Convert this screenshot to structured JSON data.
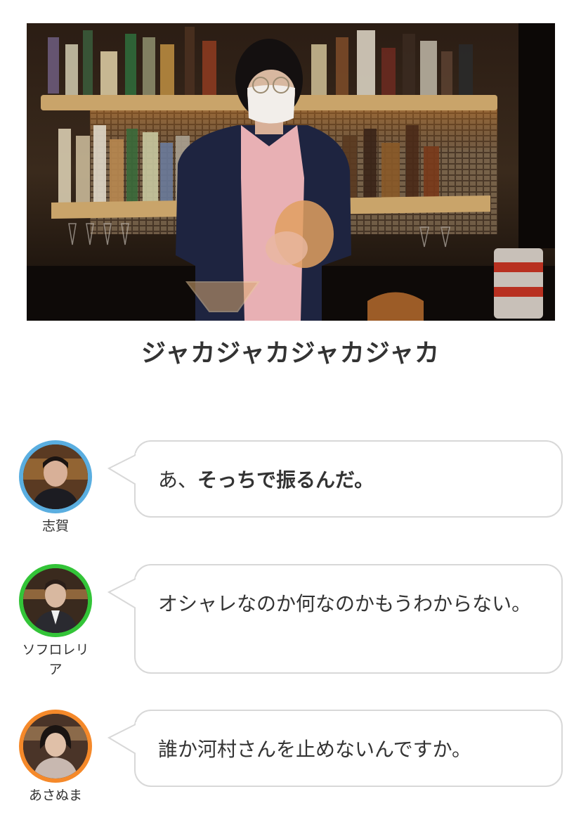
{
  "photo": {
    "alt": "bartender photo"
  },
  "caption": "ジャカジャカジャカジャカ",
  "messages": [
    {
      "speaker": "志賀",
      "ring_color": "#5aaee0",
      "text_plain": "あ、",
      "text_bold": "そっちで振るんだ。"
    },
    {
      "speaker": "ソフロレリア",
      "ring_color": "#33c438",
      "text_plain": "オシャレなのか何なのかもうわからない。",
      "text_bold": ""
    },
    {
      "speaker": "あさぬま",
      "ring_color": "#f5892a",
      "text_plain": "誰か河村さんを止めないんですか。",
      "text_bold": ""
    }
  ],
  "colors": {
    "bubble_border": "#d8d8d8",
    "text": "#333333"
  }
}
